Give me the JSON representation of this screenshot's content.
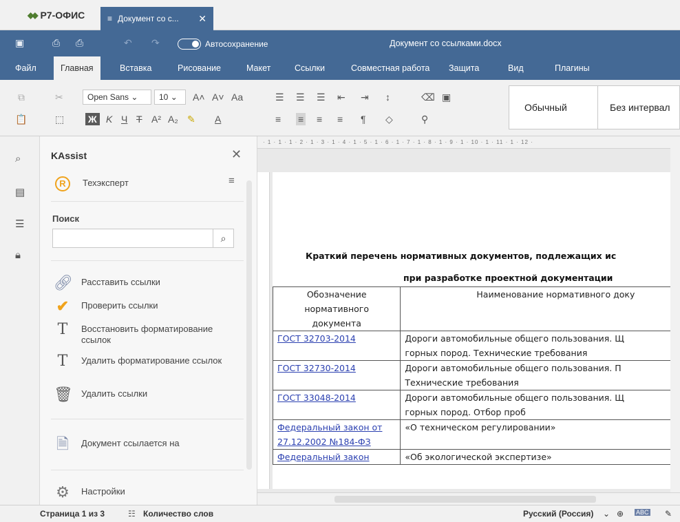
{
  "app": {
    "name": "Р7-ОФИС"
  },
  "tab": {
    "label": "Документ со с...",
    "close": "✕",
    "menu_icon": "hamburger-icon"
  },
  "titlebar": {
    "autosave_label": "Автосохранение",
    "autosave_on": true,
    "document_title": "Документ со ссылками.docx"
  },
  "menu": {
    "items": [
      "Файл",
      "Главная",
      "Вставка",
      "Рисование",
      "Макет",
      "Ссылки",
      "Совместная работа",
      "Защита",
      "Вид",
      "Плагины"
    ],
    "active": "Главная"
  },
  "toolbar": {
    "font_name": "Open Sans",
    "font_size": "10",
    "bold_label": "Ж",
    "styles": [
      "Обычный",
      "Без интервал"
    ]
  },
  "leftnav": {
    "icons": [
      "search-icon",
      "comments-icon",
      "navigation-icon",
      "lock-icon"
    ]
  },
  "plugin": {
    "title": "KAssist",
    "close": "✕",
    "provider": "Техэксперт",
    "search_label": "Поиск",
    "search_value": "",
    "actions": [
      {
        "label": "Расставить ссылки",
        "icon": "link-icon"
      },
      {
        "label": "Проверить ссылки",
        "icon": "checkmark-icon"
      },
      {
        "label": "Восстановить форматирование ссылок",
        "icon": "restore-format-icon"
      },
      {
        "label": "Удалить форматирование ссылок",
        "icon": "clear-format-icon"
      },
      {
        "label": "Удалить ссылки",
        "icon": "trash-icon"
      },
      {
        "label": "Документ ссылается на",
        "icon": "document-arrow-icon"
      },
      {
        "label": "Настройки",
        "icon": "settings-gear-icon"
      }
    ]
  },
  "ruler": {
    "ticks": "· 1 · 1 · 1 · 2 · 1 · 3 · 1 · 4 · 1 · 5 · 1 · 6 · 1 · 7 · 1 · 8 · 1 · 9 · 1 · 10 · 1 · 11 · 1 · 12 ·"
  },
  "document": {
    "heading_line1": "Краткий перечень нормативных документов, подлежащих ис",
    "heading_line2": "при разработке проектной документации",
    "table": {
      "headers": [
        "Обозначение нормативного документа",
        "Наименование нормативного доку"
      ],
      "rows": [
        {
          "code": "ГОСТ 32703-2014",
          "name_lines": [
            "Дороги автомобильные общего пользования. Щ",
            "горных пород. Технические требования"
          ]
        },
        {
          "code": "ГОСТ 32730-2014",
          "name_lines": [
            "Дороги автомобильные общего пользования. П",
            "Технические требования"
          ]
        },
        {
          "code": "ГОСТ 33048-2014",
          "name_lines": [
            "Дороги автомобильные общего пользования. Щ",
            "горных пород. Отбор проб"
          ]
        },
        {
          "code": "Федеральный закон от 27.12.2002 №184-ФЗ",
          "name_lines": [
            "«О техническом регулировании»"
          ]
        },
        {
          "code": "Федеральный закон",
          "name_lines": [
            "«Об экологической экспертизе»"
          ]
        }
      ]
    }
  },
  "status": {
    "page": "Страница 1 из 3",
    "word_count": "Количество слов",
    "language": "Русский (Россия)"
  }
}
